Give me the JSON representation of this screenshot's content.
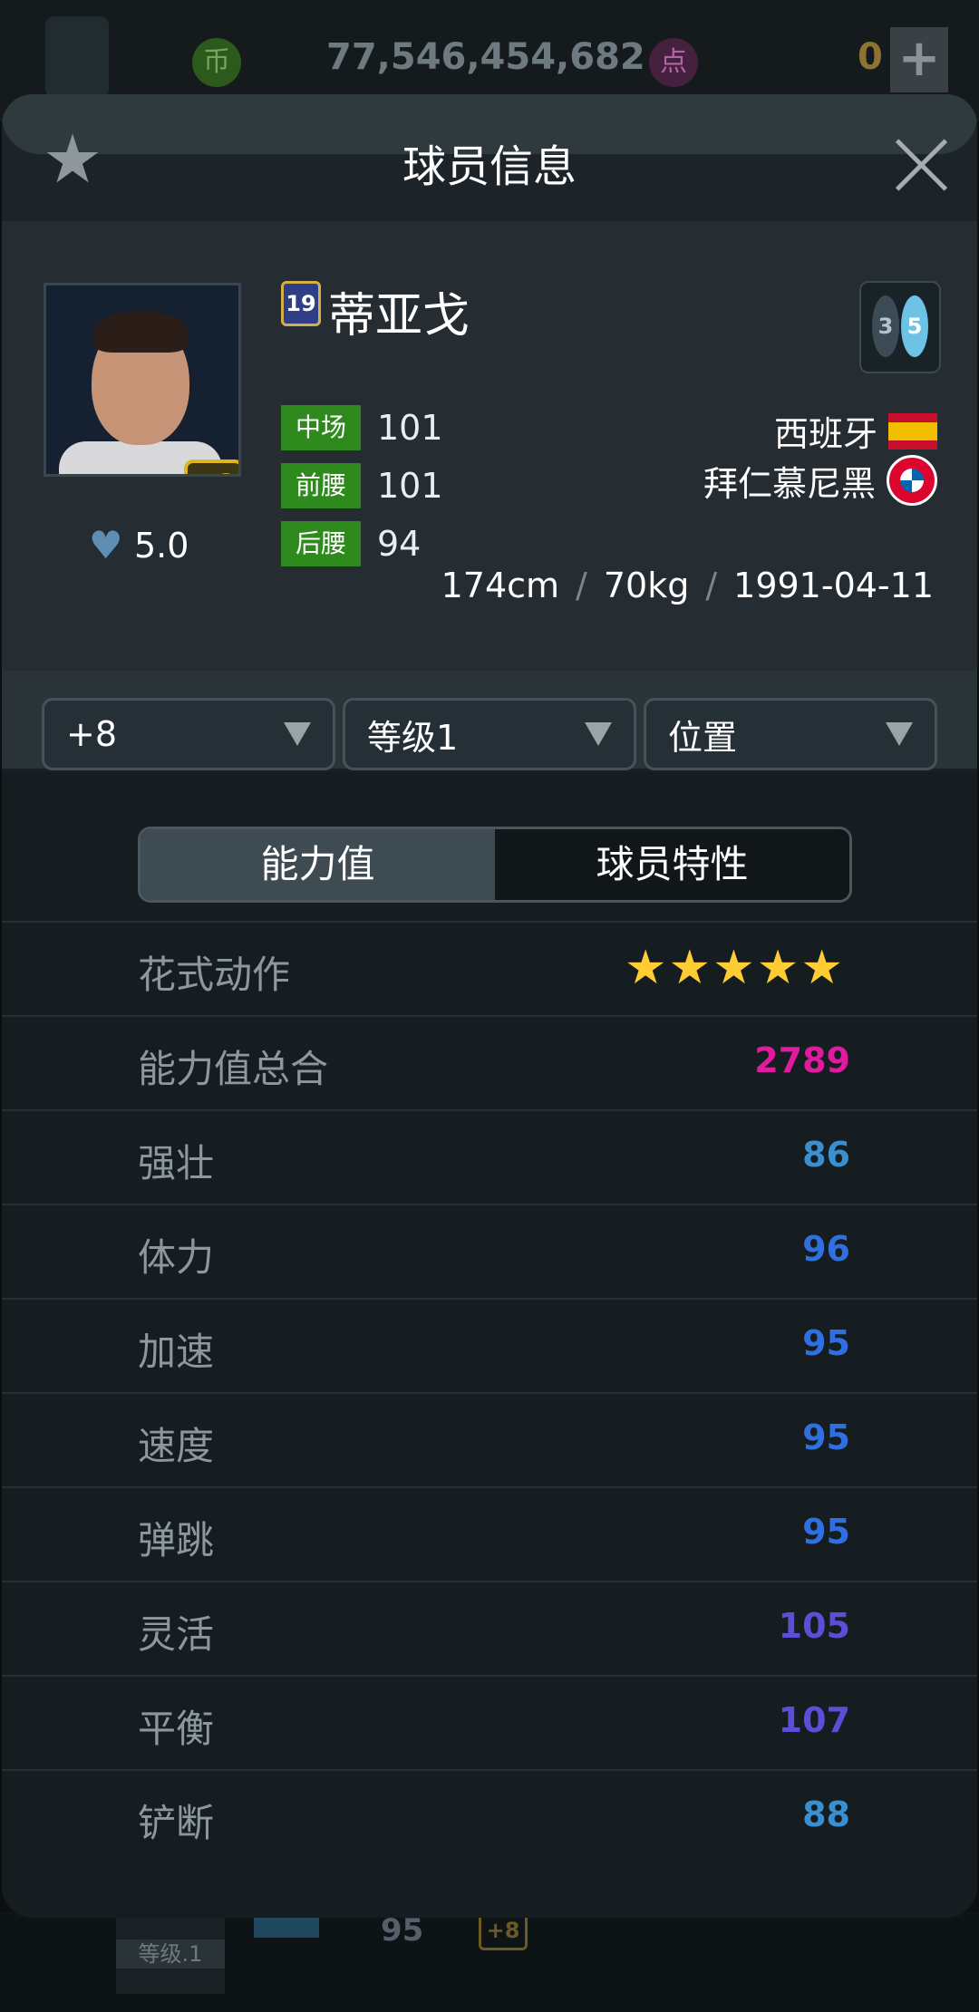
{
  "background": {
    "coin_icon_char": "币",
    "coin_value": "77,546,454,682",
    "point_icon_char": "点",
    "point_value": "0",
    "plus_label": "+",
    "list_level": "等级.1",
    "list_value": "95",
    "list_badge": "+8"
  },
  "modal": {
    "title": "球员信息",
    "star_icon": "★",
    "close_icon": "close"
  },
  "player": {
    "season": "19",
    "name": "蒂亚戈",
    "upgrade": "+8",
    "heart_rating": "5.0",
    "foot_left": "3",
    "foot_right": "5",
    "positions": [
      {
        "tag": "中场",
        "value": "101"
      },
      {
        "tag": "前腰",
        "value": "101"
      },
      {
        "tag": "后腰",
        "value": "94"
      }
    ],
    "nation": "西班牙",
    "club": "拜仁慕尼黑",
    "height": "174cm",
    "weight": "70kg",
    "birthdate": "1991-04-11",
    "separator": "/"
  },
  "filters": {
    "upgrade": "+8",
    "level": "等级1",
    "position": "位置"
  },
  "tabs": {
    "active": "能力值",
    "inactive": "球员特性"
  },
  "stats": [
    {
      "label": "花式动作",
      "value": "★★★★★",
      "color": "#ffcc33",
      "stars": 5
    },
    {
      "label": "能力值总合",
      "value": "2789",
      "color": "#e21b9e"
    },
    {
      "label": "强壮",
      "value": "86",
      "color": "#3a8fd0"
    },
    {
      "label": "体力",
      "value": "96",
      "color": "#2f6fe0"
    },
    {
      "label": "加速",
      "value": "95",
      "color": "#2f6fe0"
    },
    {
      "label": "速度",
      "value": "95",
      "color": "#2f6fe0"
    },
    {
      "label": "弹跳",
      "value": "95",
      "color": "#2f6fe0"
    },
    {
      "label": "灵活",
      "value": "105",
      "color": "#5a4fd6"
    },
    {
      "label": "平衡",
      "value": "107",
      "color": "#5a4fd6"
    },
    {
      "label": "铲断",
      "value": "88",
      "color": "#3a8fd0"
    }
  ]
}
